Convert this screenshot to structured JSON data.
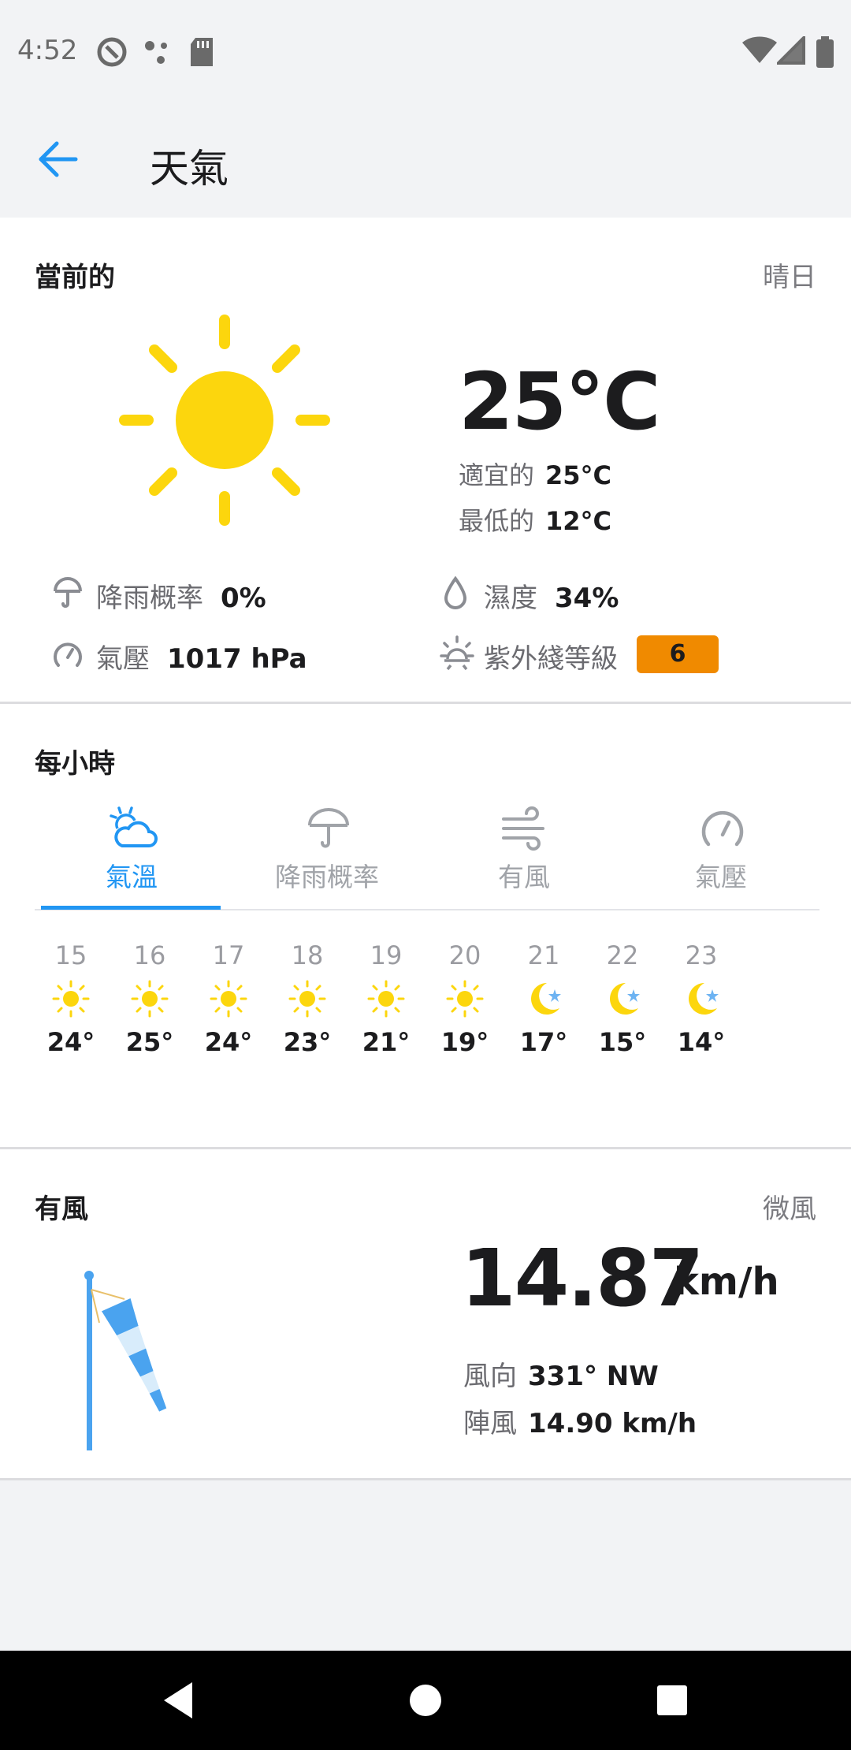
{
  "status_bar": {
    "time": "4:52"
  },
  "app_bar": {
    "title": "天氣"
  },
  "current": {
    "section_title": "當前的",
    "condition": "晴日",
    "temperature": "25°C",
    "feels_like_label": "適宜的",
    "feels_like_value": "25°C",
    "low_label": "最低的",
    "low_value": "12°C",
    "precip_label": "降雨概率",
    "precip_value": "0%",
    "humidity_label": "濕度",
    "humidity_value": "34%",
    "pressure_label": "氣壓",
    "pressure_value": "1017 hPa",
    "uv_label": "紫外綫等級",
    "uv_value": "6",
    "uv_color": "#f08a00"
  },
  "hourly": {
    "section_title": "每小時",
    "tabs": [
      {
        "label": "氣溫",
        "icon": "temperature-cloud-icon"
      },
      {
        "label": "降雨概率",
        "icon": "umbrella-icon"
      },
      {
        "label": "有風",
        "icon": "wind-icon"
      },
      {
        "label": "氣壓",
        "icon": "gauge-icon"
      }
    ],
    "hours": [
      {
        "time": "15",
        "temp": "24°",
        "icon": "sun-icon"
      },
      {
        "time": "16",
        "temp": "25°",
        "icon": "sun-icon"
      },
      {
        "time": "17",
        "temp": "24°",
        "icon": "sun-icon"
      },
      {
        "time": "18",
        "temp": "23°",
        "icon": "sun-icon"
      },
      {
        "time": "19",
        "temp": "21°",
        "icon": "sun-icon"
      },
      {
        "time": "20",
        "temp": "19°",
        "icon": "sun-icon"
      },
      {
        "time": "21",
        "temp": "17°",
        "icon": "moon-icon"
      },
      {
        "time": "22",
        "temp": "15°",
        "icon": "moon-icon"
      },
      {
        "time": "23",
        "temp": "14°",
        "icon": "moon-icon"
      }
    ]
  },
  "wind": {
    "section_title": "有風",
    "condition": "微風",
    "speed": "14.87",
    "unit": "km/h",
    "direction_label": "風向",
    "direction_value": "331° NW",
    "gust_label": "陣風",
    "gust_value": "14.90 km/h"
  },
  "colors": {
    "accent": "#2196f3",
    "sun": "#fcd60d",
    "moon_star": "#6db3f2"
  }
}
